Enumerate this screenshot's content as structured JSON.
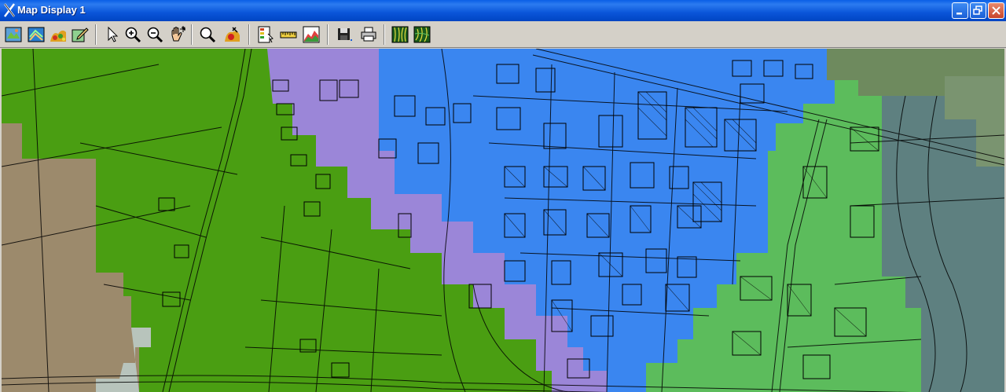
{
  "window": {
    "title": "Map Display 1"
  },
  "toolbar": {
    "buttons": [
      {
        "icon": "open-map-icon"
      },
      {
        "icon": "map-layers-icon"
      },
      {
        "icon": "raster-overlay-icon"
      },
      {
        "icon": "edit-map-icon"
      },
      {
        "icon": "select-arrow-icon"
      },
      {
        "icon": "zoom-in-icon"
      },
      {
        "icon": "zoom-out-icon"
      },
      {
        "icon": "pan-hand-icon"
      },
      {
        "icon": "zoom-extent-icon"
      },
      {
        "icon": "query-point-icon"
      },
      {
        "icon": "legend-icon"
      },
      {
        "icon": "measure-ruler-icon"
      },
      {
        "icon": "profile-icon"
      },
      {
        "icon": "save-icon"
      },
      {
        "icon": "print-icon"
      },
      {
        "icon": "display-mode-1-icon"
      },
      {
        "icon": "display-mode-2-icon"
      }
    ]
  },
  "colors": {
    "title_bar": "#0a55d9",
    "zone_green": "#4a9e12",
    "zone_light_green": "#5cbc5c",
    "zone_blue": "#3a86f0",
    "zone_purple": "#9b86d8",
    "zone_brown": "#9c8a6c",
    "zone_slate": "#5e8080",
    "zone_gray": "#b8c4bc"
  }
}
